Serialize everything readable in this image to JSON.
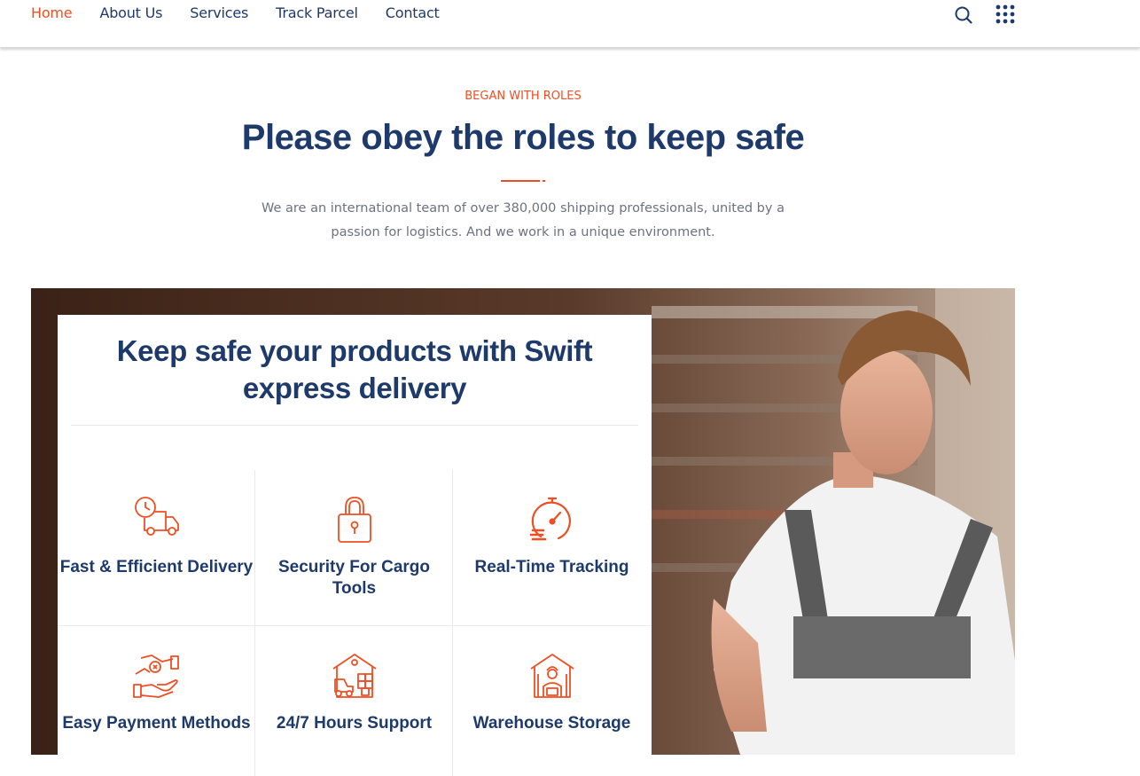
{
  "nav": {
    "links": [
      "Home",
      "About Us",
      "Services",
      "Track Parcel",
      "Contact"
    ],
    "active": "Home"
  },
  "icons": {
    "search": "search-icon",
    "menu": "dots-grid-icon"
  },
  "section": {
    "eyebrow": "BEGAN WITH ROLES",
    "title": "Please obey the roles to keep safe",
    "intro": "We are an international team of over 380,000 shipping professionals, united by a passion for logistics. And we work in a unique environment."
  },
  "card": {
    "title": "Keep safe your products with Swift express delivery",
    "features": [
      {
        "label": "Fast & Efficient Delivery",
        "icon": "delivery-truck-clock-icon"
      },
      {
        "label": "Security For Cargo Tools",
        "icon": "padlock-icon"
      },
      {
        "label": "Real-Time Tracking",
        "icon": "stopwatch-icon"
      },
      {
        "label": "Easy Payment Methods",
        "icon": "hand-payment-icon"
      },
      {
        "label": "24/7 Hours Support",
        "icon": "forklift-warehouse-icon"
      },
      {
        "label": "Warehouse Storage",
        "icon": "warehouse-worker-icon"
      }
    ]
  },
  "colors": {
    "accent": "#ef4e23",
    "navy": "#1e3a6b",
    "muted": "#6b7280"
  }
}
